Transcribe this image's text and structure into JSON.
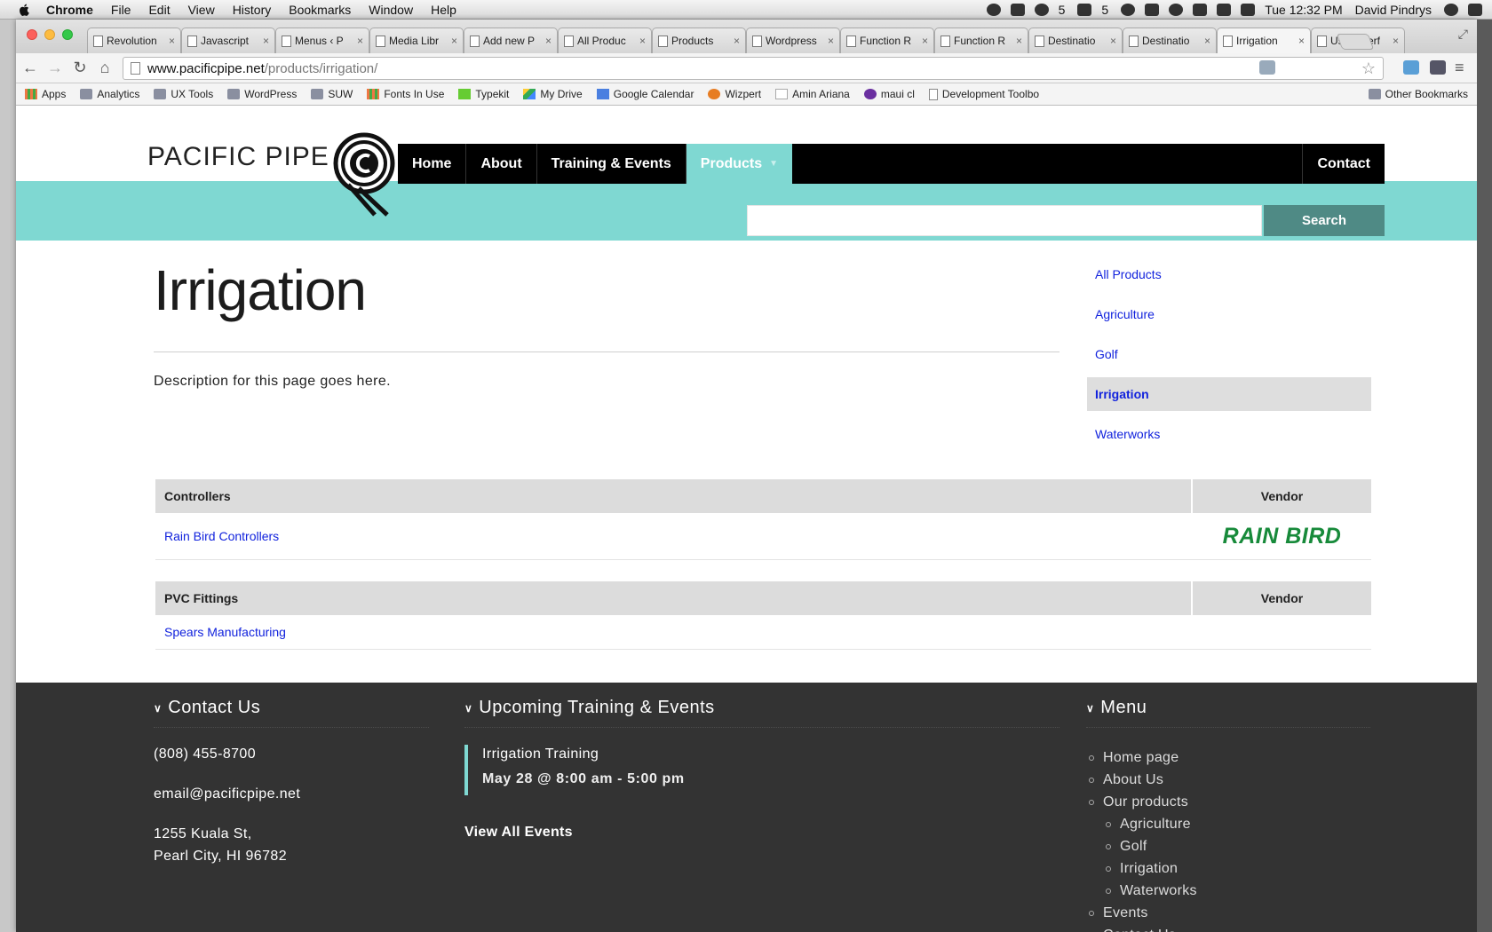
{
  "menubar": {
    "app": "Chrome",
    "items": [
      "File",
      "Edit",
      "View",
      "History",
      "Bookmarks",
      "Window",
      "Help"
    ],
    "badge_count_1": "5",
    "badge_count_2": "5",
    "clock": "Tue 12:32 PM",
    "user": "David Pindrys"
  },
  "browser": {
    "tabs": [
      {
        "title": "Revolution",
        "active": false
      },
      {
        "title": "Javascript",
        "active": false
      },
      {
        "title": "Menus ‹ P",
        "active": false
      },
      {
        "title": "Media Libr",
        "active": false
      },
      {
        "title": "Add new P",
        "active": false
      },
      {
        "title": "All Produc",
        "active": false
      },
      {
        "title": "Products",
        "active": false
      },
      {
        "title": "Wordpress",
        "active": false
      },
      {
        "title": "Function R",
        "active": false
      },
      {
        "title": "Function R",
        "active": false
      },
      {
        "title": "Destinatio",
        "active": false
      },
      {
        "title": "Destinatio",
        "active": false
      },
      {
        "title": "Irrigation",
        "active": true
      },
      {
        "title": "User Interf",
        "active": false
      }
    ],
    "url_host": "www.pacificpipe.net",
    "url_path": "/products/irrigation/",
    "bookmarks": [
      {
        "label": "Apps",
        "icon": "apps-grid-icon"
      },
      {
        "label": "Analytics",
        "icon": "folder-icon"
      },
      {
        "label": "UX Tools",
        "icon": "folder-icon"
      },
      {
        "label": "WordPress",
        "icon": "folder-icon"
      },
      {
        "label": "SUW",
        "icon": "folder-icon"
      },
      {
        "label": "Fonts In Use",
        "icon": "fonts-in-use-icon"
      },
      {
        "label": "Typekit",
        "icon": "typekit-icon"
      },
      {
        "label": "My Drive",
        "icon": "drive-icon"
      },
      {
        "label": "Google Calendar",
        "icon": "calendar-icon"
      },
      {
        "label": "Wizpert",
        "icon": "wizpert-icon"
      },
      {
        "label": "Amin Ariana",
        "icon": "aa-icon"
      },
      {
        "label": "maui cl",
        "icon": "peace-icon"
      },
      {
        "label": "Development Toolbo",
        "icon": "page-icon"
      }
    ],
    "other_bookmarks": "Other Bookmarks"
  },
  "site": {
    "logo_text": "PACIFIC PIPE CO.",
    "nav": [
      {
        "label": "Home"
      },
      {
        "label": "About"
      },
      {
        "label": "Training & Events"
      },
      {
        "label": "Products",
        "active": true
      }
    ],
    "nav_contact": "Contact",
    "search_button": "Search",
    "search_value": "",
    "accent_color": "#7fd8d2"
  },
  "main": {
    "title": "Irrigation",
    "description": "Description for this page goes here.",
    "sidenav": [
      {
        "label": "All Products",
        "current": false
      },
      {
        "label": "Agriculture",
        "current": false
      },
      {
        "label": "Golf",
        "current": false
      },
      {
        "label": "Irrigation",
        "current": true
      },
      {
        "label": "Waterworks",
        "current": false
      }
    ],
    "tables": [
      {
        "category": "Controllers",
        "vendor_header": "Vendor",
        "rows": [
          {
            "name": "Rain Bird Controllers",
            "vendor_logo": "RAIN BIRD"
          }
        ]
      },
      {
        "category": "PVC Fittings",
        "vendor_header": "Vendor",
        "rows": [
          {
            "name": "Spears Manufacturing",
            "vendor_logo": ""
          }
        ]
      }
    ]
  },
  "footer": {
    "contact_heading": "Contact Us",
    "phone": "(808) 455-8700",
    "email": "email@pacificpipe.net",
    "address_line1": "1255 Kuala St,",
    "address_line2": "Pearl City, HI 96782",
    "events_heading": "Upcoming Training & Events",
    "event_name": "Irrigation Training",
    "event_date": "May 28 @ 8:00 am - 5:00 pm",
    "view_all": "View All Events",
    "menu_heading": "Menu",
    "menu": [
      {
        "label": "Home page",
        "level": 1
      },
      {
        "label": "About Us",
        "level": 1
      },
      {
        "label": "Our products",
        "level": 1
      },
      {
        "label": "Agriculture",
        "level": 2
      },
      {
        "label": "Golf",
        "level": 2
      },
      {
        "label": "Irrigation",
        "level": 2
      },
      {
        "label": "Waterworks",
        "level": 2
      },
      {
        "label": "Events",
        "level": 1
      },
      {
        "label": "Contact Us",
        "level": 1
      }
    ]
  }
}
